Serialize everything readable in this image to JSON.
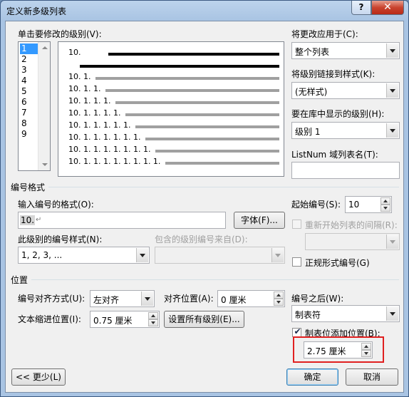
{
  "window": {
    "title": "定义新多级列表",
    "help": "?",
    "close": "✕"
  },
  "levels": {
    "label": "单击要修改的级别(V):",
    "items": [
      "1",
      "2",
      "3",
      "4",
      "5",
      "6",
      "7",
      "8",
      "9"
    ],
    "selected": "1"
  },
  "preview": {
    "level1": "10.",
    "sub": [
      "10. 1.",
      "10. 1. 1.",
      "10. 1. 1. 1.",
      "10. 1. 1. 1. 1.",
      "10. 1. 1. 1. 1. 1.",
      "10. 1. 1. 1. 1. 1. 1.",
      "10. 1. 1. 1. 1. 1. 1. 1.",
      "10. 1. 1. 1. 1. 1. 1. 1. 1."
    ]
  },
  "right_panel": {
    "apply_to_label": "将更改应用于(C):",
    "apply_to_value": "整个列表",
    "link_style_label": "将级别链接到样式(K):",
    "link_style_value": "(无样式)",
    "gallery_level_label": "要在库中显示的级别(H):",
    "gallery_level_value": "级别 1",
    "listnum_label": "ListNum 域列表名(T):",
    "listnum_value": ""
  },
  "number_format": {
    "group_title": "编号格式",
    "format_label": "输入编号的格式(O):",
    "format_value": "10.",
    "format_mark": "↵",
    "font_button": "字体(F)...",
    "style_label": "此级别的编号样式(N):",
    "style_value": "1, 2, 3, ...",
    "include_from_label": "包含的级别编号来自(D):",
    "include_from_value": "",
    "start_at_label": "起始编号(S):",
    "start_at_value": "10",
    "restart_label": "重新开始列表的间隔(R):",
    "restart_value": "",
    "legal_label": "正规形式编号(G)"
  },
  "position": {
    "group_title": "位置",
    "alignment_label": "编号对齐方式(U):",
    "alignment_value": "左对齐",
    "aligned_at_label": "对齐位置(A):",
    "aligned_at_value": "0 厘米",
    "indent_label": "文本缩进位置(I):",
    "indent_value": "0.75 厘米",
    "set_all_button": "设置所有级别(E)...",
    "follow_label": "编号之后(W):",
    "follow_value": "制表符",
    "tab_add_label": "制表位添加位置(B):",
    "tab_add_checked": "✔",
    "tab_add_value": "2.75 厘米"
  },
  "footer": {
    "less_button": "<< 更少(L)",
    "ok_button": "确定",
    "cancel_button": "取消"
  },
  "colors": {
    "highlight": "#e02020",
    "selection": "#3399ff"
  }
}
